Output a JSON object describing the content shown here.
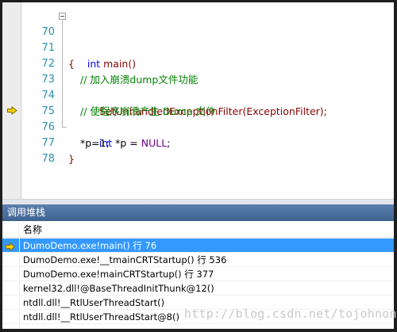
{
  "colors": {
    "keyword": "#0000ff",
    "comment": "#008000",
    "function": "#880000",
    "macro": "#6f008a",
    "line_number": "#2b91af",
    "panel_title_bg": "#4a6d9a",
    "selection": "#3399ff",
    "exec_arrow": "#f5d100"
  },
  "editor": {
    "lines": [
      {
        "num": "70",
        "t1": "int",
        "t2": " main()"
      },
      {
        "num": "71",
        "brace": "{"
      },
      {
        "num": "72",
        "comment": "// 加入崩溃dump文件功能"
      },
      {
        "num": "73",
        "fn": "SetUnhandledExceptionFilter",
        "rest": "(ExceptionFilter);"
      },
      {
        "num": "74",
        "comment": "// 使程序崩溃产生 Dump 文件"
      },
      {
        "num": "75",
        "kw": "int",
        "mid": " *p = ",
        "mac": "NULL",
        "end": ";"
      },
      {
        "num": "76",
        "text": "*p=1;"
      },
      {
        "num": "77",
        "brace": "}"
      },
      {
        "num": "78"
      }
    ],
    "current_line_icon": "execution-pointer-icon"
  },
  "callstack": {
    "title": "调用堆栈",
    "column_name": "名称",
    "rows": [
      {
        "text": "DumoDemo.exe!main() 行 76",
        "selected": true,
        "icon": "current-frame-arrow-icon"
      },
      {
        "text": "DumoDemo.exe!__tmainCRTStartup() 行 536"
      },
      {
        "text": "DumoDemo.exe!mainCRTStartup() 行 377"
      },
      {
        "text": "kernel32.dll!@BaseThreadInitThunk@12()"
      },
      {
        "text": "ntdll.dll!__RtlUserThreadStart()"
      },
      {
        "text": "ntdll.dll!__RtlUserThreadStart@8()"
      }
    ]
  },
  "watermark": "http://blog.csdn.net/tojohnonly"
}
